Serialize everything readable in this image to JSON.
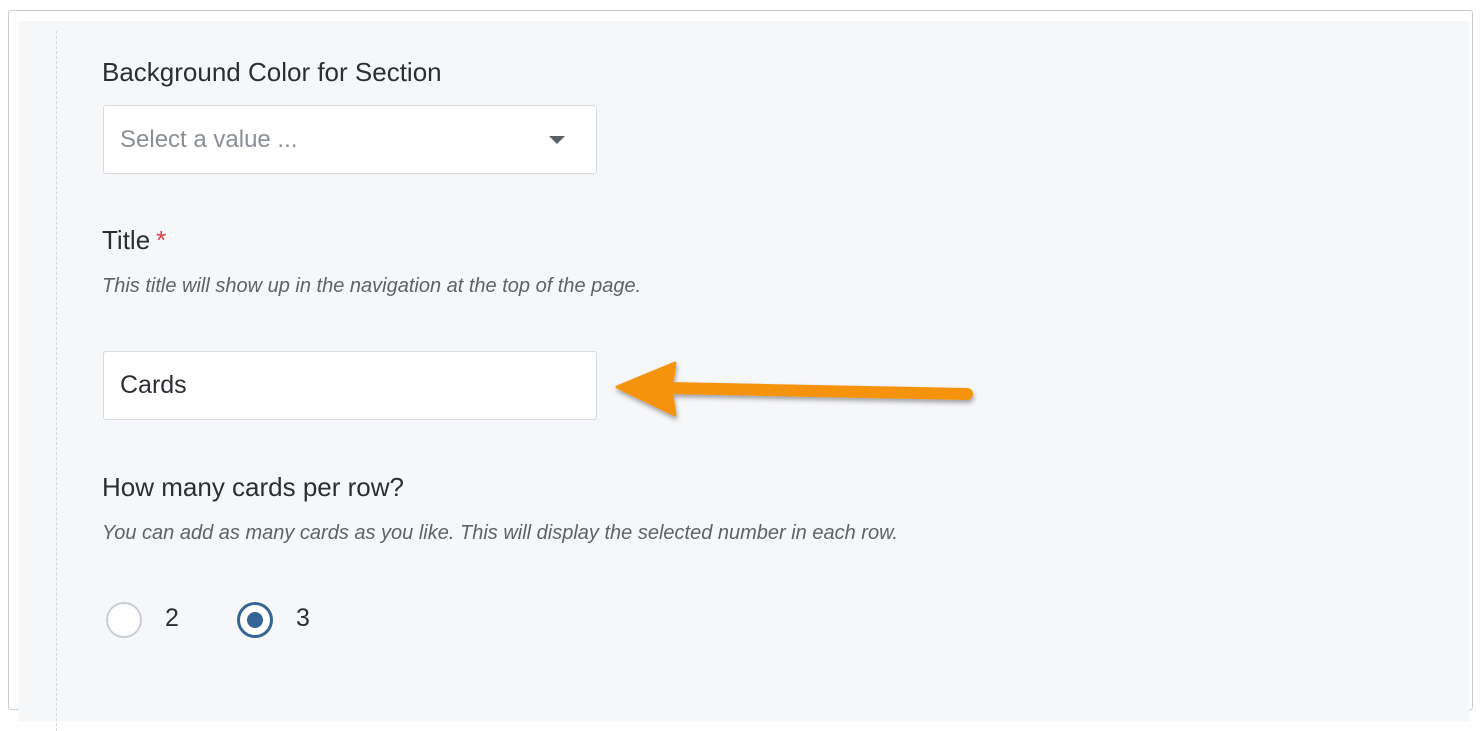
{
  "form": {
    "background_color": {
      "label": "Background Color for Section",
      "placeholder": "Select a value ..."
    },
    "title": {
      "label": "Title",
      "required_marker": "*",
      "help": "This title will show up in the navigation at the top of the page.",
      "value": "Cards"
    },
    "cards_per_row": {
      "label": "How many cards per row?",
      "help": "You can add as many cards as you like. This will display the selected number in each row.",
      "options": [
        {
          "label": "2",
          "selected": false
        },
        {
          "label": "3",
          "selected": true
        }
      ]
    }
  },
  "annotation": {
    "arrow_color": "#f5930f",
    "arrow_icon": "left-arrow-icon"
  },
  "colors": {
    "panel_background": "#f6f7f9",
    "radio_selected": "#356597",
    "required": "#e23c3c"
  }
}
